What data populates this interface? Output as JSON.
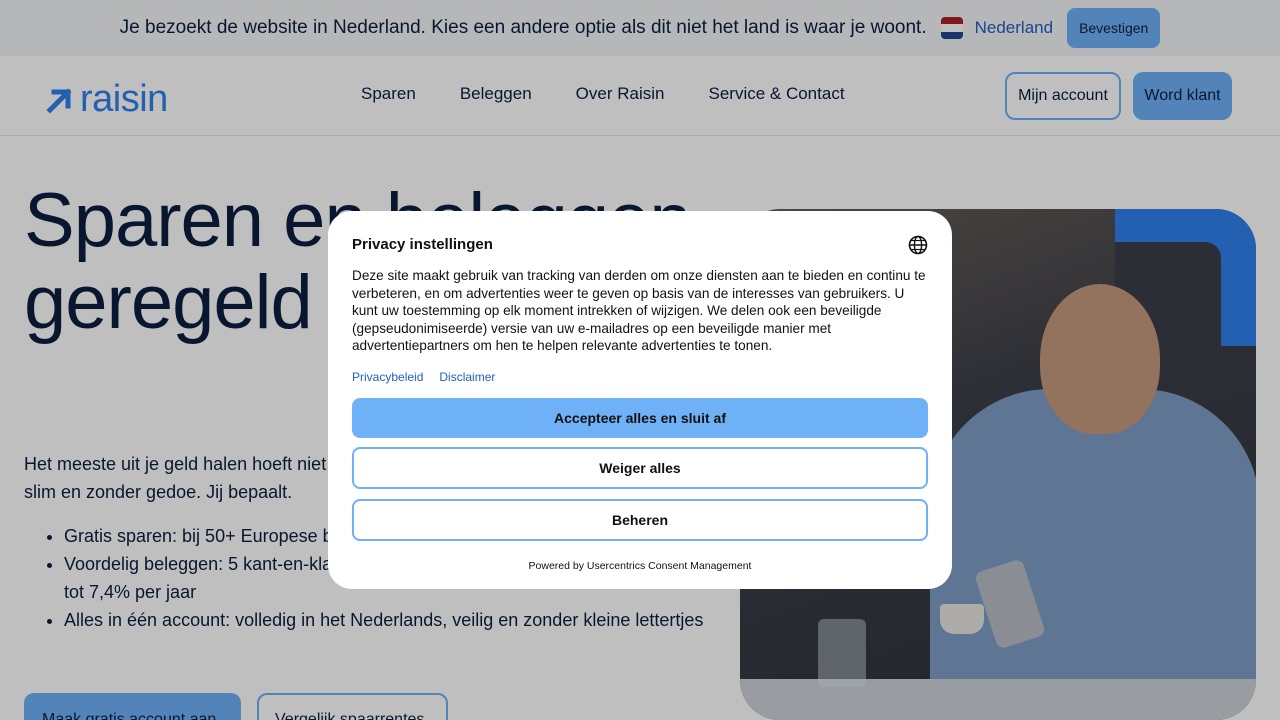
{
  "country_banner": {
    "text": "Je bezoekt de website in Nederland. Kies een andere optie als dit niet het land is waar je woont.",
    "country": "Nederland",
    "confirm_label": "Bevestigen",
    "flag_colors": [
      "#ae1c28",
      "#ffffff",
      "#21468b"
    ]
  },
  "header": {
    "logo_text": "raisin",
    "nav": [
      "Sparen",
      "Beleggen",
      "Over Raisin",
      "Service & Contact"
    ],
    "account_label": "Mijn account",
    "client_label": "Word klant"
  },
  "hero": {
    "title": "Sparen en beleggen geregeld",
    "intro": "Het meeste uit je geld halen hoeft niet ingewikkeld te zijn. Bij ons spaar en beleg je slim en zonder gedoe. Jij bepaalt.",
    "bullets": [
      "Gratis sparen: bij 50+ Europese banken",
      "Voordelig beleggen: 5 kant-en-klare portefeuilles met een verwacht rendement tot 7,4% per jaar",
      "Alles in één account: volledig in het Nederlands, veilig en zonder kleine lettertjes"
    ],
    "primary_cta": "Maak gratis account aan",
    "secondary_cta": "Vergelijk spaarrentes"
  },
  "privacy_modal": {
    "title": "Privacy instellingen",
    "body": "Deze site maakt gebruik van tracking van derden om onze diensten aan te bieden en continu te verbeteren, en om advertenties weer te geven op basis van de interesses van gebruikers. U kunt uw toestemming op elk moment intrekken of wijzigen. We delen ook een beveiligde (gepseudonimiseerde) versie van uw e-mailadres op een beveiligde manier met advertentiepartners om hen te helpen relevante advertenties te tonen.",
    "links": [
      "Privacybeleid",
      "Disclaimer"
    ],
    "accept_label": "Accepteer alles en sluit af",
    "deny_label": "Weiger alles",
    "manage_label": "Beheren",
    "footer": "Powered by Usercentrics Consent Management"
  },
  "colors": {
    "accent": "#6fb1f7",
    "brand": "#2f80ed",
    "text": "#0b1f3f"
  }
}
